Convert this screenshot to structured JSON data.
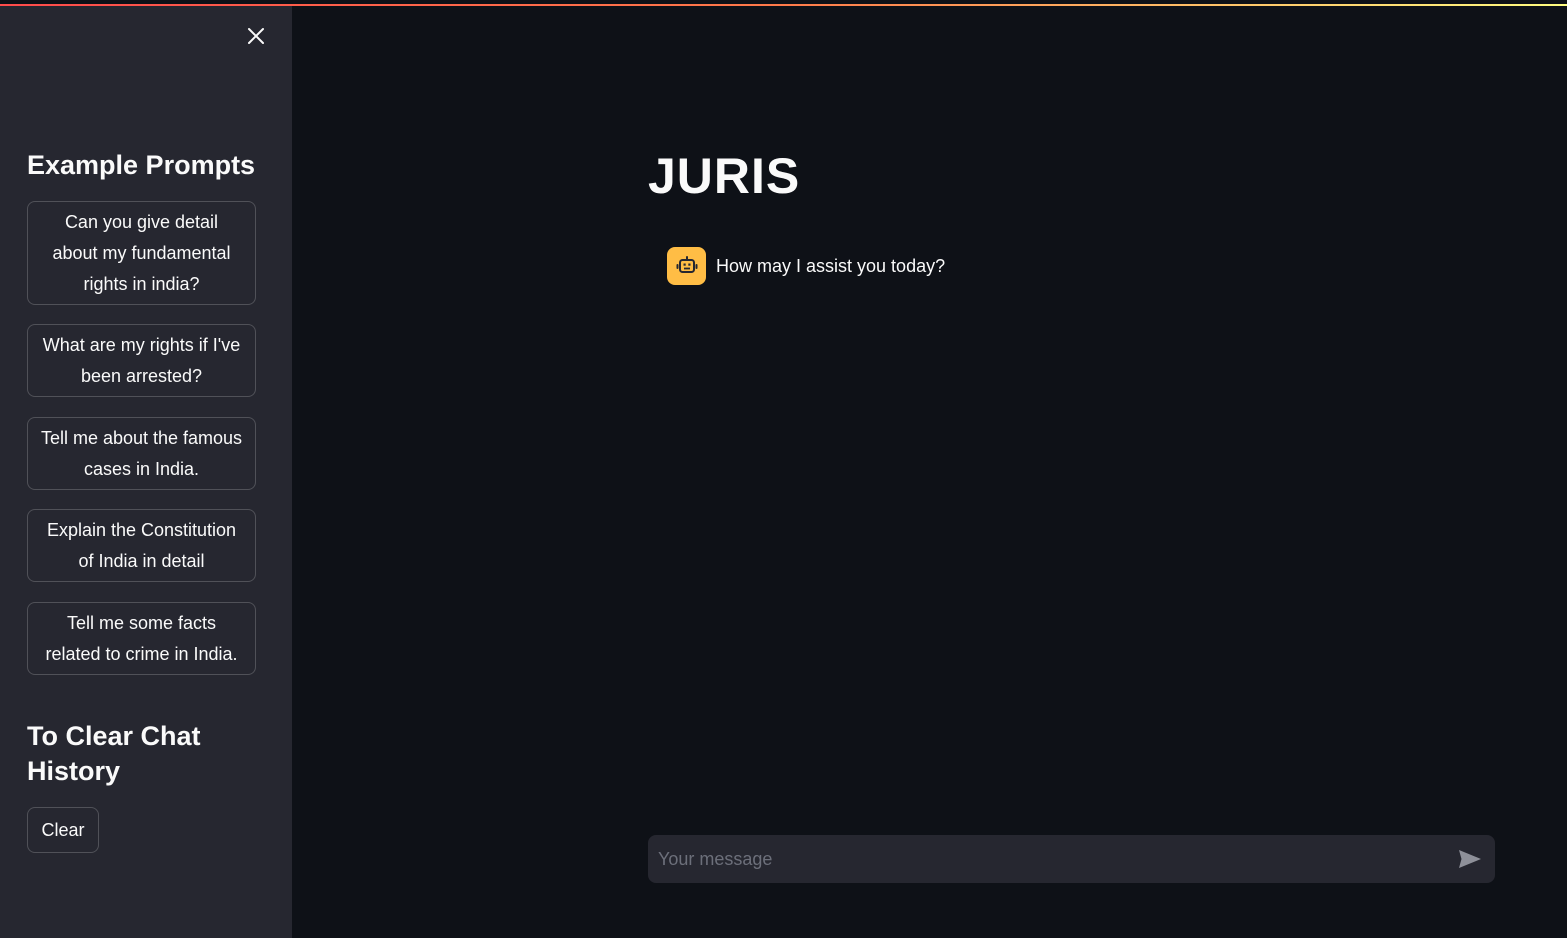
{
  "sidebar": {
    "example_heading": "Example Prompts",
    "prompts": [
      "Can you give detail about my fundamental rights in india?",
      "What are my rights if I've been arrested?",
      "Tell me about the famous cases in India.",
      "Explain the Constitution of India in detail",
      "Tell me some facts related to crime in India."
    ],
    "clear_heading": "To Clear Chat History",
    "clear_label": "Clear"
  },
  "main": {
    "title": "JURIS",
    "messages": [
      {
        "role": "assistant",
        "avatar_icon": "robot-icon",
        "text": "How may I assist you today?"
      }
    ]
  },
  "chat_input": {
    "placeholder": "Your message"
  },
  "colors": {
    "background": "#0e1117",
    "sidebar": "#262730",
    "avatar": "#ffbd45"
  }
}
